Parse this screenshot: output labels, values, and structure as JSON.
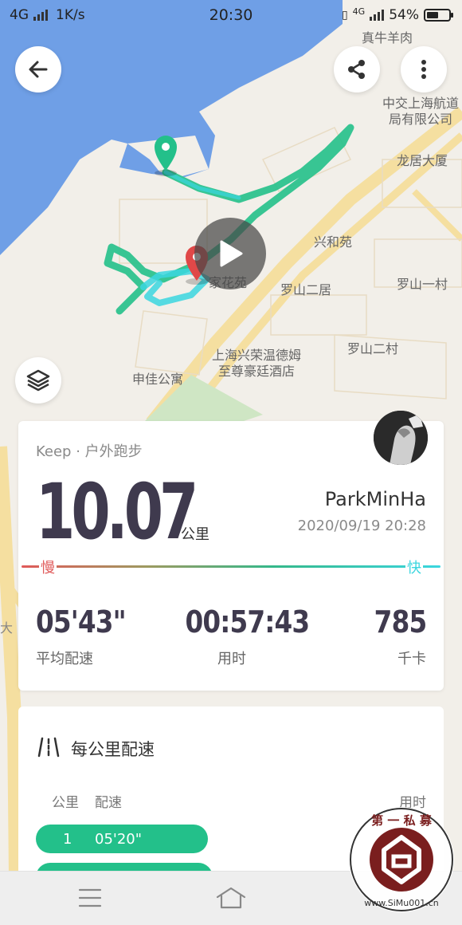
{
  "status_bar": {
    "network": "4G",
    "speed": "1K/s",
    "time": "20:30",
    "network2": "4G",
    "battery_text": "54%",
    "battery_level": 0.54
  },
  "map": {
    "labels": {
      "food": "真牛羊肉",
      "company": "中交上海航道局有限公司",
      "company_line1": "中交上海航道",
      "company_line2": "局有限公司",
      "building": "龙居大厦",
      "xinghe": "兴和苑",
      "garden": "家花苑",
      "luoshan2ju": "罗山二居",
      "luoshan1cun": "罗山一村",
      "luoshan2cun": "罗山二村",
      "hotel_line1": "上海兴荣温德姆",
      "hotel_line2": "至尊豪廷酒店",
      "shenjia": "申佳公寓"
    },
    "colors": {
      "water": "#6f9fe6",
      "land": "#f2efe9",
      "road": "#f5dfa0",
      "route": "#23c08a",
      "route_alt": "#3bd6df"
    }
  },
  "top_buttons": {
    "back_icon": "arrow-left-icon",
    "share_icon": "share-icon",
    "more_icon": "more-vertical-icon",
    "layers_icon": "layers-icon",
    "play_icon": "play-icon"
  },
  "stats": {
    "source": "Keep · 户外跑步",
    "distance": "10.07",
    "distance_unit": "公里",
    "user_name": "ParkMinHa",
    "datetime": "2020/09/19 20:28",
    "pace_slow": "慢",
    "pace_fast": "快",
    "metrics": [
      {
        "value": "05'43\"",
        "label": "平均配速"
      },
      {
        "value": "00:57:43",
        "label": "用时"
      },
      {
        "value": "785",
        "label": "千卡"
      }
    ]
  },
  "splits": {
    "title": "每公里配速",
    "col_km": "公里",
    "col_pace": "配速",
    "col_time": "用时",
    "rows": [
      {
        "km": "1",
        "pace": "05'20\""
      }
    ]
  },
  "nav": {
    "menu_icon": "menu-icon",
    "home_icon": "home-icon"
  },
  "watermark": {
    "text_top": "第 一 私 募",
    "text_bottom": "www.SiMu001.cn"
  }
}
